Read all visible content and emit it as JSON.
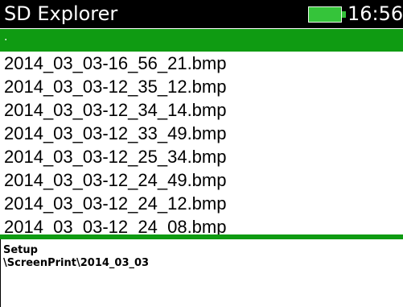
{
  "header": {
    "title": "SD Explorer",
    "time": "16:56",
    "battery_icon": "battery-full-icon",
    "battery_color": "#35c43a"
  },
  "file_list": {
    "parent_entry": ".",
    "files": [
      "2014_03_03-16_56_21.bmp",
      "2014_03_03-12_35_12.bmp",
      "2014_03_03-12_34_14.bmp",
      "2014_03_03-12_33_49.bmp",
      "2014_03_03-12_25_34.bmp",
      "2014_03_03-12_24_49.bmp",
      "2014_03_03-12_24_12.bmp",
      "2014_03_03-12_24_08.bmp"
    ],
    "selected_color": "#0f9b12"
  },
  "info_panel": {
    "line1": "Setup",
    "line2": "\\ScreenPrint\\2014_03_03"
  }
}
